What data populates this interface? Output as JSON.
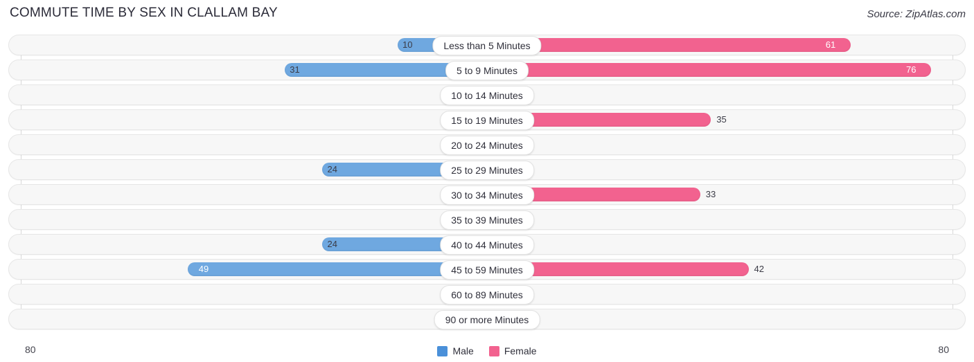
{
  "header": {
    "title": "COMMUTE TIME BY SEX IN CLALLAM BAY",
    "source": "Source: ZipAtlas.com"
  },
  "axis": {
    "left_tick": "80",
    "right_tick": "80"
  },
  "legend": {
    "items": [
      {
        "label": "Male",
        "color": "#4a90d9"
      },
      {
        "label": "Female",
        "color": "#f2628f"
      }
    ]
  },
  "colors": {
    "male": "#6fa8e0",
    "male_zero": "#aecbec",
    "female": "#f2628f",
    "female_zero": "#f9a8c3",
    "track": "#f7f7f7",
    "track_border": "#e6e6e6"
  },
  "chart_data": {
    "type": "bar",
    "title": "COMMUTE TIME BY SEX IN CLALLAM BAY",
    "subtitle": "Source: ZipAtlas.com",
    "orientation": "horizontal-diverging",
    "xlabel": "",
    "ylabel": "",
    "xlim": [
      80,
      80
    ],
    "axis_max": 80,
    "grid": false,
    "legend_position": "bottom-center",
    "categories": [
      "Less than 5 Minutes",
      "5 to 9 Minutes",
      "10 to 14 Minutes",
      "15 to 19 Minutes",
      "20 to 24 Minutes",
      "25 to 29 Minutes",
      "30 to 34 Minutes",
      "35 to 39 Minutes",
      "40 to 44 Minutes",
      "45 to 59 Minutes",
      "60 to 89 Minutes",
      "90 or more Minutes"
    ],
    "series": [
      {
        "name": "Male",
        "values": [
          10,
          31,
          0,
          0,
          0,
          24,
          0,
          0,
          24,
          49,
          0,
          0
        ]
      },
      {
        "name": "Female",
        "values": [
          61,
          76,
          0,
          35,
          0,
          0,
          33,
          0,
          0,
          42,
          0,
          0
        ]
      }
    ]
  },
  "rows": [
    {
      "category": "Less than 5 Minutes",
      "male": "10",
      "female": "61",
      "male_val": 10,
      "female_val": 61
    },
    {
      "category": "5 to 9 Minutes",
      "male": "31",
      "female": "76",
      "male_val": 31,
      "female_val": 76
    },
    {
      "category": "10 to 14 Minutes",
      "male": "0",
      "female": "0",
      "male_val": 0,
      "female_val": 0
    },
    {
      "category": "15 to 19 Minutes",
      "male": "0",
      "female": "35",
      "male_val": 0,
      "female_val": 35
    },
    {
      "category": "20 to 24 Minutes",
      "male": "0",
      "female": "0",
      "male_val": 0,
      "female_val": 0
    },
    {
      "category": "25 to 29 Minutes",
      "male": "24",
      "female": "0",
      "male_val": 24,
      "female_val": 0
    },
    {
      "category": "30 to 34 Minutes",
      "male": "0",
      "female": "33",
      "male_val": 0,
      "female_val": 33
    },
    {
      "category": "35 to 39 Minutes",
      "male": "0",
      "female": "0",
      "male_val": 0,
      "female_val": 0
    },
    {
      "category": "40 to 44 Minutes",
      "male": "24",
      "female": "0",
      "male_val": 24,
      "female_val": 0
    },
    {
      "category": "45 to 59 Minutes",
      "male": "49",
      "female": "42",
      "male_val": 49,
      "female_val": 42
    },
    {
      "category": "60 to 89 Minutes",
      "male": "0",
      "female": "0",
      "male_val": 0,
      "female_val": 0
    },
    {
      "category": "90 or more Minutes",
      "male": "0",
      "female": "0",
      "male_val": 0,
      "female_val": 0
    }
  ]
}
